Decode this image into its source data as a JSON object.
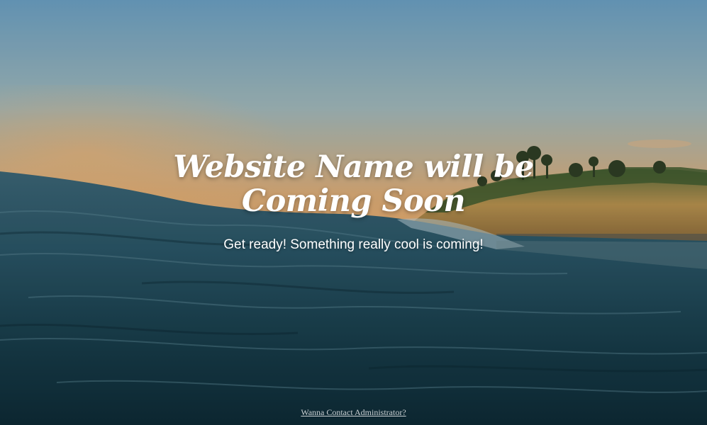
{
  "hero": {
    "title": "Website Name will be Coming Soon",
    "subtitle": "Get ready! Something really cool is coming!"
  },
  "footer": {
    "contact_link": "Wanna Contact Administrator?"
  },
  "colors": {
    "sky_top": "#6a9ec0",
    "sky_horizon": "#e6a867",
    "sea_dark": "#0e2a35",
    "sea_mid": "#2a5566",
    "text": "#ffffff",
    "link": "#c9cfd2"
  }
}
